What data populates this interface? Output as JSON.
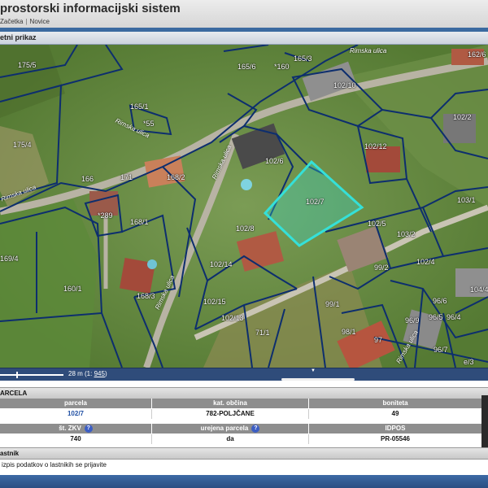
{
  "header": {
    "title": "prostorski informacijski sistem",
    "nav": [
      "Začetka",
      "Novice"
    ],
    "nav_sep": "|"
  },
  "panel": {
    "title": "etni prikaz"
  },
  "map": {
    "highlight_color": "#35e0d8",
    "parcel_line_color": "#0d2e6e",
    "street_labels": [
      "Rimska ulica",
      "Rimska ulica",
      "Rimska ulica",
      "Rimska ulica",
      "Rimska ulica"
    ],
    "parcel_labels": [
      "175/5",
      "175/4",
      "169/4",
      "160/1",
      "165/1",
      "*55",
      "166",
      "171",
      "168/2",
      "*289",
      "168/1",
      "168/3",
      "165/6",
      "*160",
      "165/3",
      "102/10",
      "102/6",
      "102/7",
      "102/8",
      "102/14",
      "102/15",
      "102/13",
      "71/1",
      "99/1",
      "102/12",
      "102/5",
      "103/2",
      "102/4",
      "99/2",
      "102/2",
      "103/1",
      "104/4",
      "96/6",
      "96/5",
      "96/4",
      "96/9",
      "98/1",
      "97",
      "96/7",
      "162/6",
      "e/3",
      "Rimska ulica"
    ]
  },
  "scale": {
    "text": "28 m (1:",
    "ratio": "945",
    "suffix": ")"
  },
  "parcela": {
    "section_title": "ARCELA",
    "headers1": [
      "parcela",
      "kat. občina",
      "boniteta"
    ],
    "values1": [
      "102/7",
      "782-POLJČANE",
      "49"
    ],
    "headers2": [
      "št. ZKV",
      "urejena parcela",
      "IDPOS"
    ],
    "values2": [
      "740",
      "da",
      "PR-05546"
    ],
    "help_glyph": "?"
  },
  "owner": {
    "section_title": "astnik",
    "text": "izpis podatkov o lastnikih se prijavite"
  }
}
